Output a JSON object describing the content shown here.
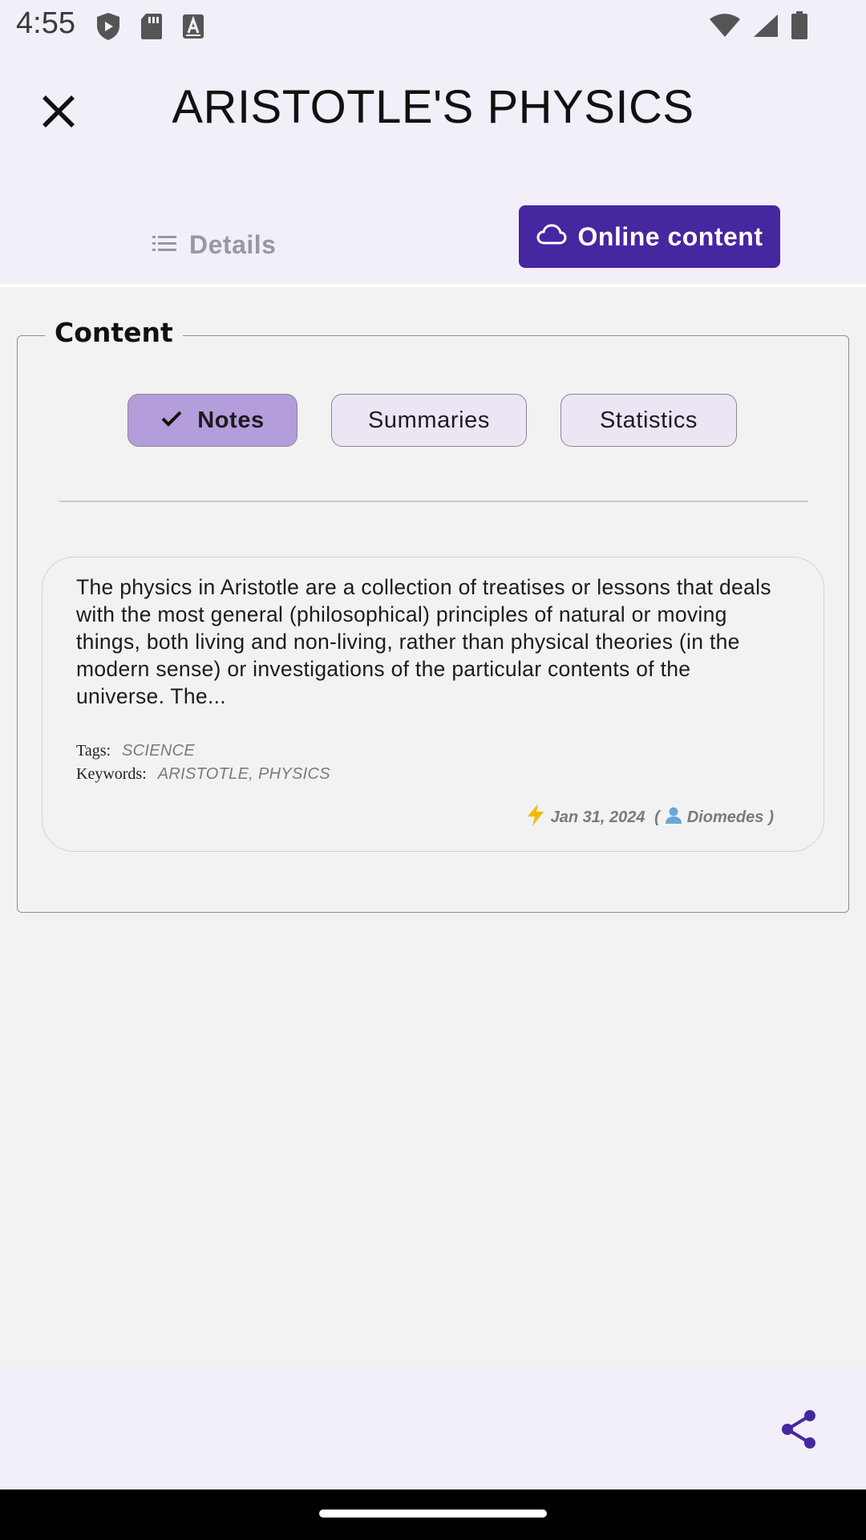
{
  "status_bar": {
    "time": "4:55",
    "icons_left": [
      "shield-icon",
      "sd-card-icon",
      "font-a-icon"
    ],
    "icons_right": [
      "wifi-icon",
      "cell-signal-icon",
      "battery-icon"
    ]
  },
  "header": {
    "title": "ARISTOTLE'S PHYSICS",
    "tabs": [
      {
        "label": "Details",
        "icon": "list-icon",
        "active": false
      },
      {
        "label": "Online content",
        "icon": "cloud-icon",
        "active": true
      }
    ]
  },
  "content": {
    "legend": "Content",
    "filters": [
      {
        "label": "Notes",
        "selected": true
      },
      {
        "label": "Summaries",
        "selected": false
      },
      {
        "label": "Statistics",
        "selected": false
      }
    ],
    "note": {
      "text": "The physics in Aristotle are a collection of treatises or lessons that deals with the most general (philosophical) principles of natural or moving things, both living and non-living, rather than physical theories (in the modern sense) or investigations of the particular contents of the universe. The...",
      "tags_label": "Tags:",
      "tags_value": "SCIENCE",
      "keywords_label": "Keywords:",
      "keywords_value": "ARISTOTLE, PHYSICS",
      "date": "Jan 31, 2024",
      "author": "Diomedes"
    }
  },
  "colors": {
    "accent": "#4527a0",
    "chip_selected": "#b39ddb",
    "chip_unselected": "#ece6f4",
    "header_bg": "#f2eff8"
  }
}
